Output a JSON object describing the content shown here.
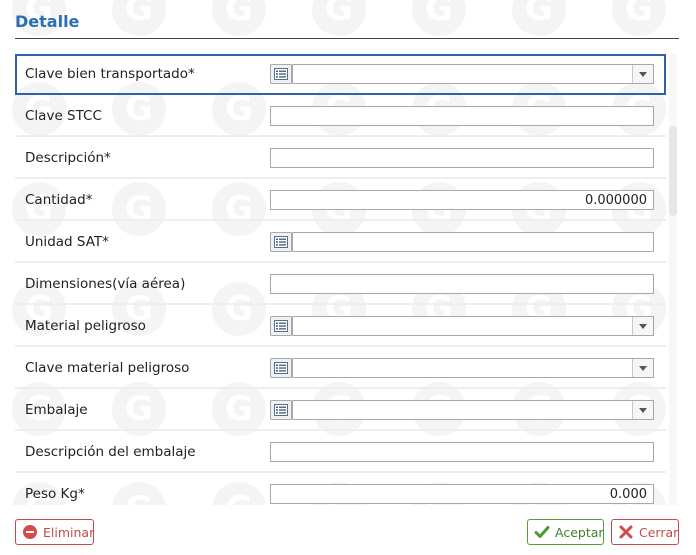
{
  "header": {
    "title": "Detalle"
  },
  "rows": [
    {
      "label": "Clave bien transportado*",
      "value": "",
      "type": "select",
      "picker": true,
      "focused": true
    },
    {
      "label": "Clave STCC",
      "value": "",
      "type": "text",
      "picker": false
    },
    {
      "label": "Descripción*",
      "value": "",
      "type": "text",
      "picker": false
    },
    {
      "label": "Cantidad*",
      "value": "0.000000",
      "type": "number",
      "picker": false
    },
    {
      "label": "Unidad SAT*",
      "value": "",
      "type": "text",
      "picker": true
    },
    {
      "label": "Dimensiones(vía aérea)",
      "value": "",
      "type": "text",
      "picker": false
    },
    {
      "label": "Material peligroso",
      "value": "",
      "type": "select",
      "picker": true
    },
    {
      "label": "Clave material peligroso",
      "value": "",
      "type": "select",
      "picker": true
    },
    {
      "label": "Embalaje",
      "value": "",
      "type": "select",
      "picker": true
    },
    {
      "label": "Descripción del embalaje",
      "value": "",
      "type": "text",
      "picker": false
    },
    {
      "label": "Peso Kg*",
      "value": "0.000",
      "type": "number",
      "picker": false
    }
  ],
  "footer": {
    "delete_label": "Eliminar",
    "accept_label": "Aceptar",
    "cancel_label": "Cerrar"
  },
  "colors": {
    "title": "#2a6eb8",
    "focus_border": "#2f63a8",
    "danger": "#c24b4b",
    "success": "#5a9e3a"
  },
  "watermark_text": "G"
}
